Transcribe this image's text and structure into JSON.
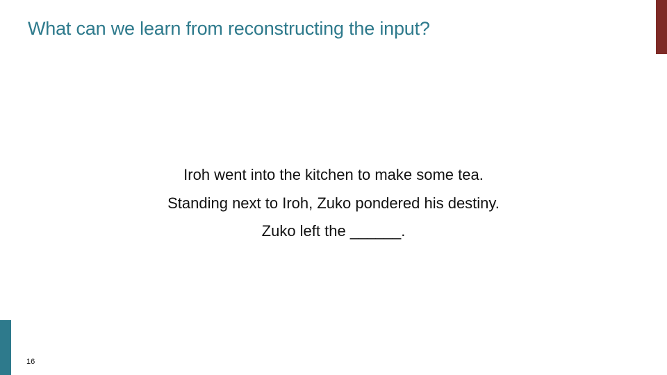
{
  "slide": {
    "title": "What can we learn from reconstructing the input?",
    "lines": [
      "Iroh went into the kitchen to make some tea.",
      "Standing next to Iroh, Zuko pondered his destiny.",
      "Zuko left the ______."
    ],
    "page_number": "16"
  },
  "colors": {
    "title": "#2e7a8c",
    "accent_right": "#7e2a26",
    "accent_left": "#2e7a8c",
    "text": "#111111",
    "background": "#ffffff"
  }
}
